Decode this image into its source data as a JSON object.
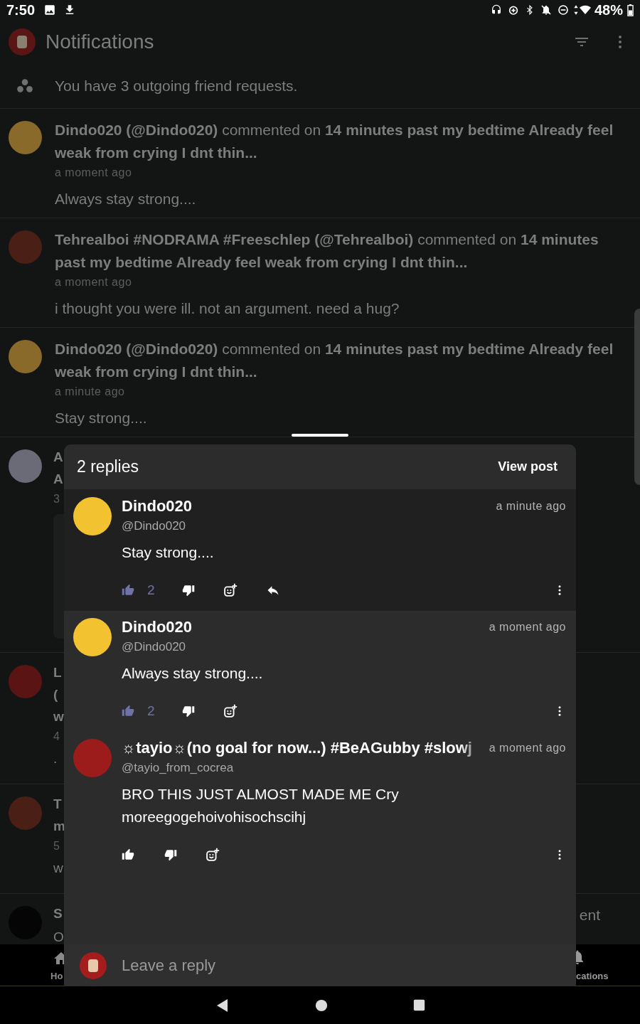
{
  "status_bar": {
    "time": "7:50",
    "battery": "48%"
  },
  "app_bar": {
    "title": "Notifications"
  },
  "friend_requests": {
    "text": "You have 3 outgoing friend requests."
  },
  "notifications": [
    {
      "kind": "full",
      "color": "#8a6a2a",
      "headline": "**Dindo020 (@Dindo020)** commented on **14 minutes past my bedtime Already feel weak from crying I dnt thin...**",
      "time": "a moment ago",
      "comment": "Always stay strong...."
    },
    {
      "kind": "full",
      "color": "#4a1f16",
      "headline": "**Tehrealboi #NODRAMA #Freeschlep (@Tehrealboi)** commented on **14 minutes past my bedtime Already feel weak from crying I dnt thin...**",
      "time": "a moment ago",
      "comment": "i thought you were ill. not an argument. need a hug?"
    },
    {
      "kind": "full",
      "color": "#8a6a2a",
      "headline": "**Dindo020 (@Dindo020)** commented on **14 minutes past my bedtime Already feel weak from crying I dnt thin...**",
      "time": "a minute ago",
      "comment": "Stay strong...."
    },
    {
      "kind": "partial",
      "color": "#6b6b78",
      "lines": [
        {
          "kind": "headline",
          "text": "A"
        },
        {
          "kind": "headline",
          "text": "A"
        },
        {
          "kind": "time",
          "text": "3"
        },
        {
          "kind": "preview"
        }
      ]
    },
    {
      "kind": "partial",
      "color": "#5a1414",
      "lines": [
        {
          "kind": "headline",
          "text": "L"
        },
        {
          "kind": "headline",
          "text": "("
        },
        {
          "kind": "headline",
          "text": "w"
        },
        {
          "kind": "time",
          "text": "4"
        },
        {
          "kind": "comment",
          "text": "."
        }
      ]
    },
    {
      "kind": "partial",
      "color": "#4a1f16",
      "lines": [
        {
          "kind": "headline",
          "text": "T"
        },
        {
          "kind": "headline",
          "text": "m"
        },
        {
          "kind": "time",
          "text": "5"
        },
        {
          "kind": "comment",
          "text": "w"
        }
      ]
    },
    {
      "kind": "partial",
      "color": "#050505",
      "right_text": "ent",
      "lines": [
        {
          "kind": "headline",
          "text": "S"
        },
        {
          "kind": "comment",
          "text": "O"
        }
      ]
    }
  ],
  "sheet": {
    "title": "2 replies",
    "view_post": "View post",
    "reply_placeholder": "Leave a reply",
    "replies": [
      {
        "name": "Dindo020",
        "handle": "@Dindo020",
        "time": "a minute ago",
        "color": "#f2c230",
        "highlighted": true,
        "text": "Stay strong....",
        "liked": true,
        "likes": "2",
        "reply_button": true
      },
      {
        "name": "Dindo020",
        "handle": "@Dindo020",
        "time": "a moment ago",
        "color": "#f2c230",
        "highlighted": false,
        "text": "Always stay strong....",
        "liked": true,
        "likes": "2",
        "reply_button": false
      },
      {
        "name": "☼tayio☼(no goal for now...) #BeAGubby #slowj",
        "handle": "@tayio_from_cocrea",
        "time": "a moment ago",
        "color": "#9c1c1c",
        "highlighted": false,
        "text": "BRO THIS JUST ALMOST MADE ME Cry moreegogehoivohisochscihj",
        "liked": false,
        "reply_button": false
      }
    ]
  },
  "bottom_nav": {
    "left_label": "Ho",
    "right_label": "cations"
  }
}
